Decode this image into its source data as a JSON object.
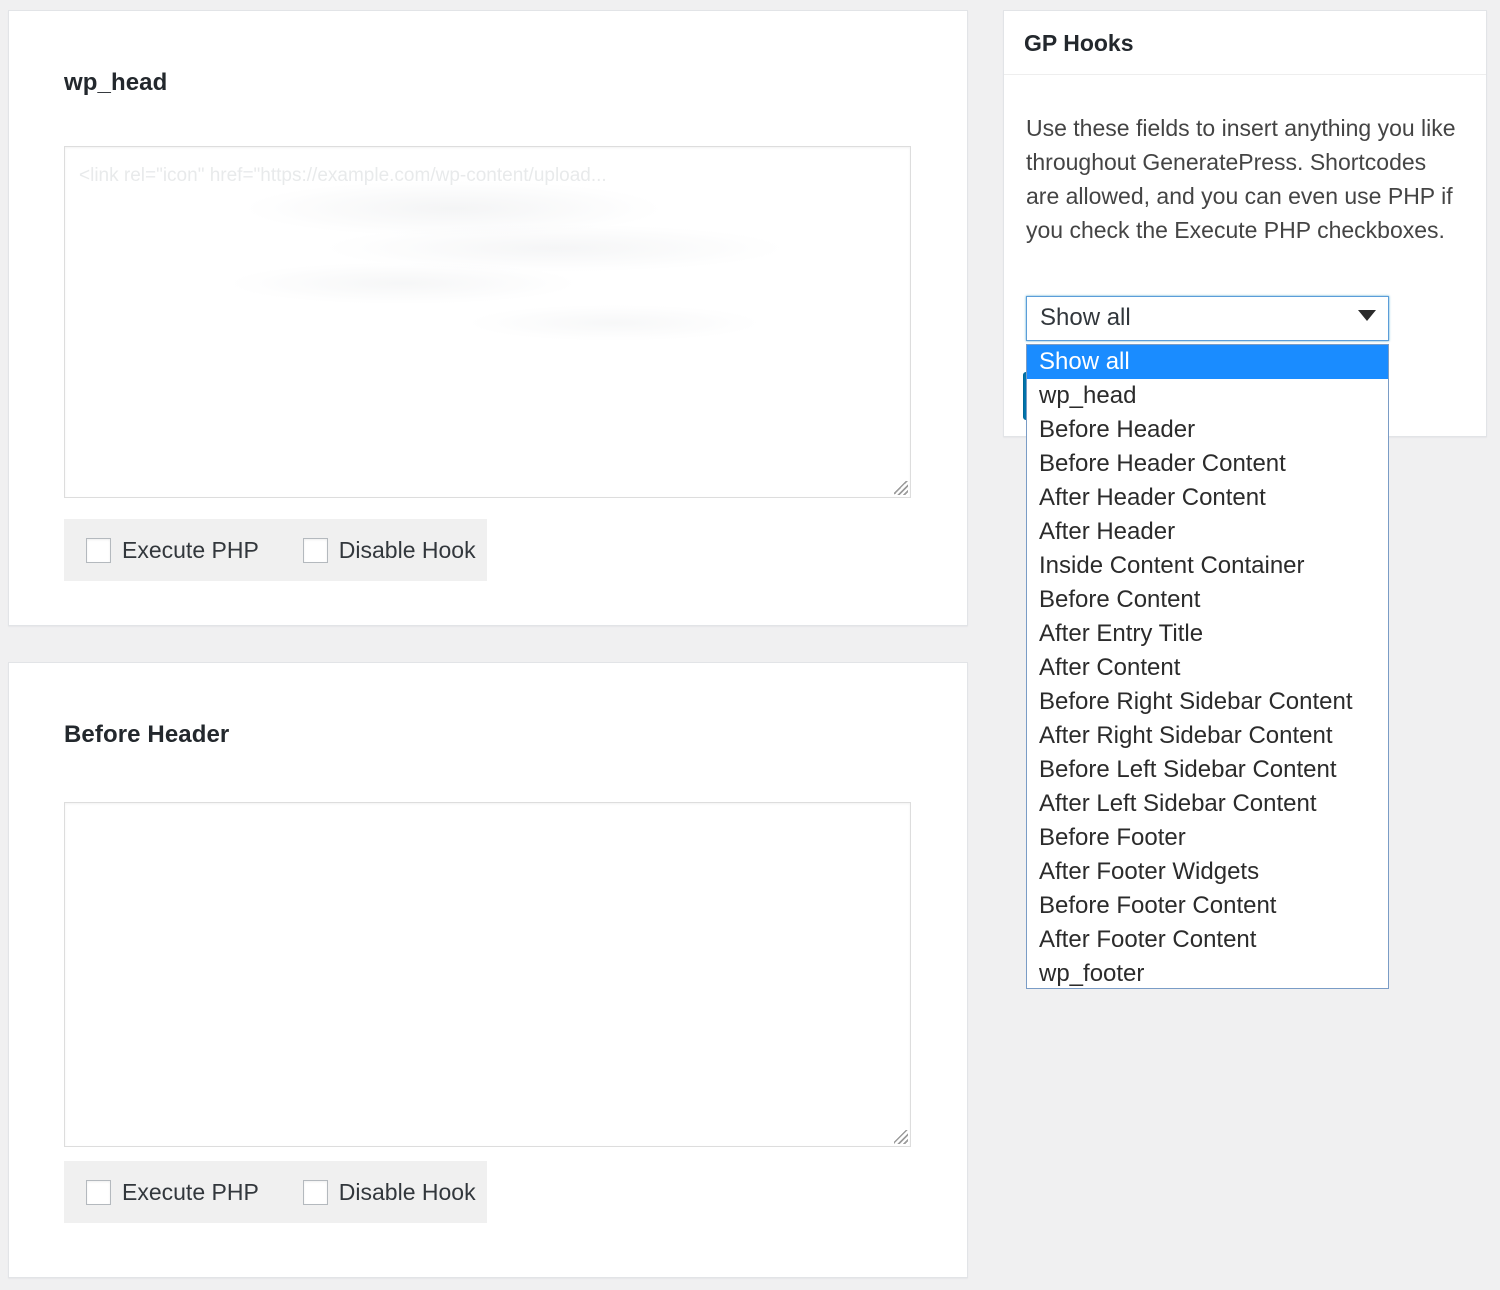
{
  "hook_cards": [
    {
      "title": "wp_head",
      "textarea_value": "<link rel=\"icon\" href=\"https://example.com/wp-content/upload...",
      "textarea_placeholder": "",
      "execute_php_label": "Execute PHP",
      "disable_hook_label": "Disable Hook",
      "execute_php_checked": false,
      "disable_hook_checked": false
    },
    {
      "title": "Before Header",
      "textarea_value": "",
      "textarea_placeholder": "",
      "execute_php_label": "Execute PHP",
      "disable_hook_label": "Disable Hook",
      "execute_php_checked": false,
      "disable_hook_checked": false
    }
  ],
  "sidebar": {
    "panel_title": "GP Hooks",
    "description": "Use these fields to insert anything you like throughout GeneratePress. Shortcodes are allowed, and you can even use PHP if you check the Execute PHP checkboxes.",
    "select": {
      "selected_value": "Show all",
      "arrow_icon": "chevron-down-icon",
      "expanded": true,
      "options": [
        "Show all",
        "wp_head",
        "Before Header",
        "Before Header Content",
        "After Header Content",
        "After Header",
        "Inside Content Container",
        "Before Content",
        "After Entry Title",
        "After Content",
        "Before Right Sidebar Content",
        "After Right Sidebar Content",
        "Before Left Sidebar Content",
        "After Left Sidebar Content",
        "Before Footer",
        "After Footer Widgets",
        "Before Footer Content",
        "After Footer Content",
        "wp_footer"
      ],
      "highlighted_index": 0
    }
  },
  "colors": {
    "page_background": "#f0f0f1",
    "card_background": "#ffffff",
    "card_border": "#e2e4e7",
    "heading_text": "#23282d",
    "body_text": "#444444",
    "select_focus_border": "#5b9dd9",
    "option_highlight": "#1a8cff",
    "option_highlight_text": "#ffffff",
    "checkbox_bar_background": "#f0f0f0",
    "primary_button": "#0073aa"
  }
}
